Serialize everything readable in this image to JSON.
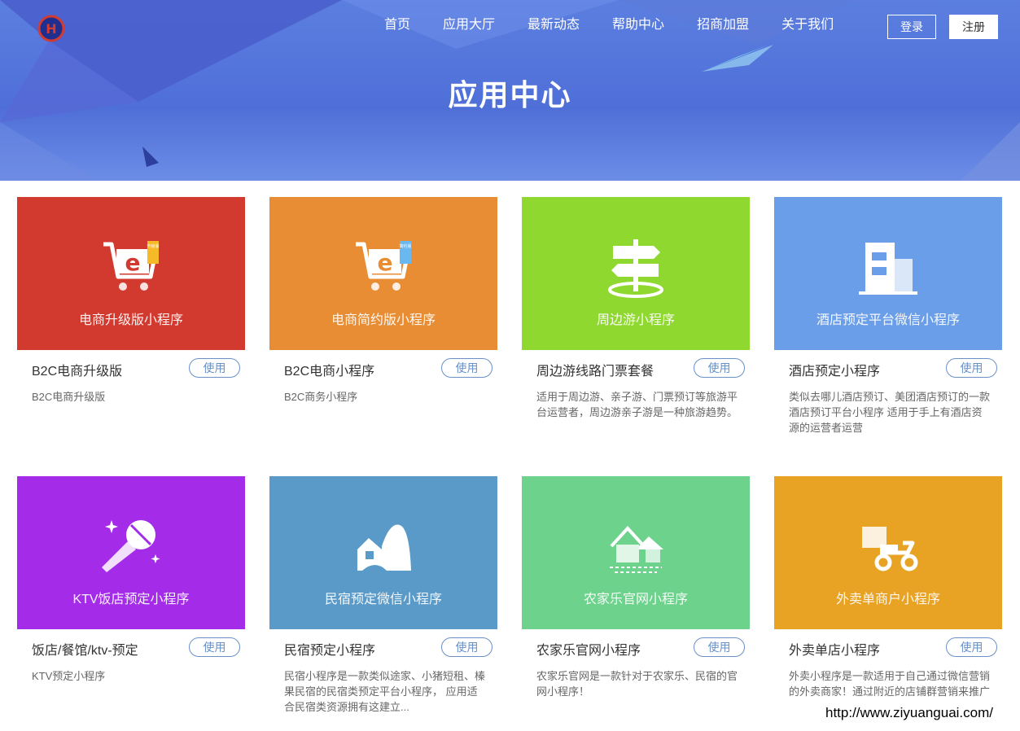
{
  "header": {
    "nav": [
      "首页",
      "应用大厅",
      "最新动态",
      "帮助中心",
      "招商加盟",
      "关于我们"
    ],
    "login_label": "登录",
    "register_label": "注册"
  },
  "hero": {
    "title": "应用中心"
  },
  "cards": [
    {
      "caption": "电商升级版小程序",
      "name": "B2C电商升级版",
      "desc": "B2C电商升级版",
      "use_label": "使用",
      "color": "#d33a2f",
      "icon": "shopping-cart-icon",
      "badge": "升级版"
    },
    {
      "caption": "电商简约版小程序",
      "name": "B2C电商小程序",
      "desc": "B2C商务小程序",
      "use_label": "使用",
      "color": "#e88d33",
      "icon": "shopping-cart-icon",
      "badge": "简约版"
    },
    {
      "caption": "周边游小程序",
      "name": "周边游线路门票套餐",
      "desc": "适用于周边游、亲子游、门票预订等旅游平台运营者，周边游亲子游是一种旅游趋势。",
      "use_label": "使用",
      "color": "#8fd82f",
      "icon": "signpost-icon"
    },
    {
      "caption": "酒店预定平台微信小程序",
      "name": "酒店预定小程序",
      "desc": "类似去哪儿酒店预订、美团酒店预订的一款酒店预订平台小程序 适用于手上有酒店资源的运营者运营",
      "use_label": "使用",
      "color": "#6a9ee8",
      "icon": "hotel-icon"
    },
    {
      "caption": "KTV饭店预定小程序",
      "name": "饭店/餐馆/ktv-预定",
      "desc": "KTV预定小程序",
      "use_label": "使用",
      "color": "#a42ce8",
      "icon": "microphone-icon"
    },
    {
      "caption": "民宿预定微信小程序",
      "name": "民宿预定小程序",
      "desc": "民宿小程序是一款类似途家、小猪短租、榛果民宿的民宿类预定平台小程序， 应用适合民宿类资源拥有这建立...",
      "use_label": "使用",
      "color": "#5a9ac8",
      "icon": "homestay-icon"
    },
    {
      "caption": "农家乐官网小程序",
      "name": "农家乐官网小程序",
      "desc": "农家乐官网是一款针对于农家乐、民宿的官网小程序！",
      "use_label": "使用",
      "color": "#6dd28c",
      "icon": "farmhouse-icon"
    },
    {
      "caption": "外卖单商户小程序",
      "name": "外卖单店小程序",
      "desc": "外卖小程序是一款适用于自己通过微信营销的外卖商家！通过附近的店铺群营销来推广",
      "use_label": "使用",
      "color": "#e8a224",
      "icon": "delivery-scooter-icon"
    }
  ],
  "watermark": "http://www.ziyuanguai.com/"
}
